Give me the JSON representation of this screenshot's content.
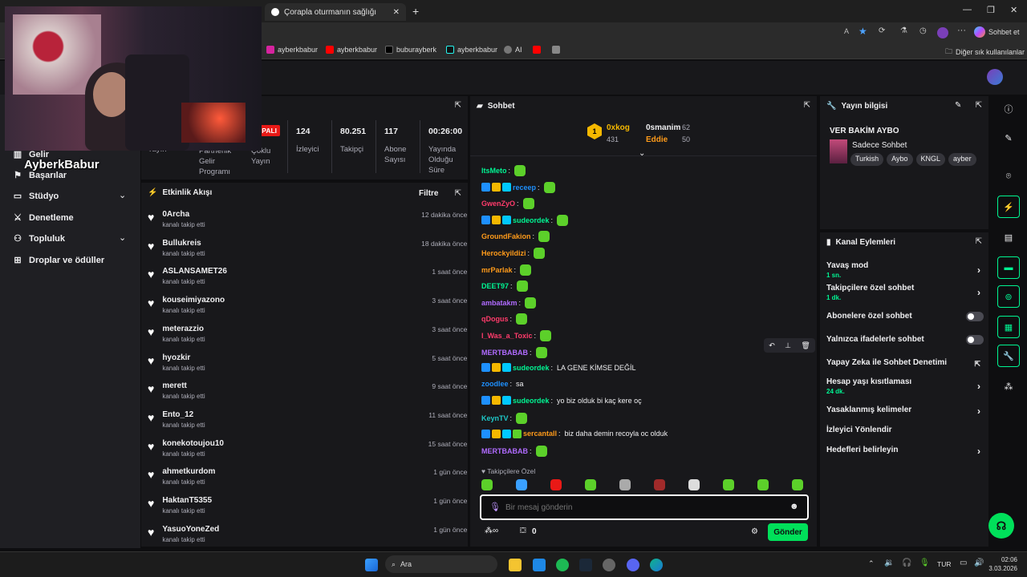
{
  "browser": {
    "tab_active_label": "Çorapla oturmanın sağlığı",
    "copilot_label": "Sohbet et",
    "bookmarks": [
      "ayberkbabur",
      "ayberkbabur",
      "buburayberk",
      "ayberkbabur",
      "AI"
    ],
    "other_bookmarks": "Diğer sık kullanılanlar"
  },
  "webcam": {
    "overlay_name": "AyberkBabur"
  },
  "sidebar": {
    "items": [
      {
        "label": "Gelir",
        "icon": "chart-icon"
      },
      {
        "label": "Başarılar",
        "icon": "trophy-icon"
      },
      {
        "label": "Stüdyo",
        "icon": "studio-icon"
      },
      {
        "label": "Denetleme",
        "icon": "sword-icon"
      },
      {
        "label": "Topluluk",
        "icon": "people-icon"
      },
      {
        "label": "Droplar ve ödüller",
        "icon": "gift-icon"
      }
    ]
  },
  "stats": {
    "status_badge": "KAPALI",
    "cols": [
      {
        "value": "",
        "label": "Yayın"
      },
      {
        "value": "",
        "label": "Partnerlik Gelir Programı"
      },
      {
        "value": "",
        "label": "Çoklu Yayın"
      },
      {
        "value": "124",
        "label": "İzleyici"
      },
      {
        "value": "80.251",
        "label": "Takipçi"
      },
      {
        "value": "117",
        "label": "Abone Sayısı"
      },
      {
        "value": "00:26:00",
        "label": "Yayında Olduğu Süre"
      }
    ]
  },
  "activity": {
    "title": "Etkinlik Akışı",
    "filter_label": "Filtre",
    "items": [
      {
        "name": "0Archa",
        "sub": "kanalı takip etti",
        "time": "12 dakika önce"
      },
      {
        "name": "Bullukreis",
        "sub": "kanalı takip etti",
        "time": "18 dakika önce"
      },
      {
        "name": "ASLANSAMET26",
        "sub": "kanalı takip etti",
        "time": "1 saat önce"
      },
      {
        "name": "kouseimiyazono",
        "sub": "kanalı takip etti",
        "time": "3 saat önce"
      },
      {
        "name": "meterazzio",
        "sub": "kanalı takip etti",
        "time": "3 saat önce"
      },
      {
        "name": "hyozkir",
        "sub": "kanalı takip etti",
        "time": "5 saat önce"
      },
      {
        "name": "merett",
        "sub": "kanalı takip etti",
        "time": "9 saat önce"
      },
      {
        "name": "Ento_12",
        "sub": "kanalı takip etti",
        "time": "11 saat önce"
      },
      {
        "name": "konekotoujou10",
        "sub": "kanalı takip etti",
        "time": "15 saat önce"
      },
      {
        "name": "ahmetkurdom",
        "sub": "kanalı takip etti",
        "time": "1 gün önce"
      },
      {
        "name": "HaktanT5355",
        "sub": "kanalı takip etti",
        "time": "1 gün önce"
      },
      {
        "name": "YasuoYoneZed",
        "sub": "kanalı takip etti",
        "time": "1 gün önce"
      }
    ]
  },
  "chat": {
    "title": "Sohbet",
    "leaderboard": {
      "rank": "1",
      "first": {
        "name": "0xkog",
        "score": "431"
      },
      "second": {
        "name": "0smanim",
        "score": "62"
      },
      "third": {
        "name": "Eddie",
        "score": "50"
      }
    },
    "messages": [
      {
        "user": "ItsMeto",
        "color": "#00f593",
        "text": "",
        "badges": 0
      },
      {
        "user": "receep",
        "color": "#1e90ff",
        "text": "",
        "badges": 3
      },
      {
        "user": "GwenZyO",
        "color": "#ff3b6b",
        "text": "",
        "badges": 0
      },
      {
        "user": "sudeordek",
        "color": "#00f593",
        "text": "",
        "badges": 3
      },
      {
        "user": "GroundFakion",
        "color": "#ff9b1a",
        "text": "",
        "badges": 0
      },
      {
        "user": "Herockyildizi",
        "color": "#ff9b1a",
        "text": "",
        "badges": 0
      },
      {
        "user": "mrParlak",
        "color": "#ff9b1a",
        "text": "",
        "badges": 0
      },
      {
        "user": "DEET97",
        "color": "#00f593",
        "text": "",
        "badges": 0
      },
      {
        "user": "ambatakm",
        "color": "#b06bff",
        "text": "",
        "badges": 0
      },
      {
        "user": "qDogus",
        "color": "#ff3b6b",
        "text": "",
        "badges": 0
      },
      {
        "user": "I_Was_a_Toxic",
        "color": "#ff3b6b",
        "text": "",
        "badges": 0
      },
      {
        "user": "MERTBABAB",
        "color": "#b06bff",
        "text": "",
        "badges": 0
      },
      {
        "user": "sudeordek",
        "color": "#00f593",
        "text": "LA GENE KİMSE DEĞİL",
        "badges": 3
      },
      {
        "user": "zoodlee",
        "color": "#1e90ff",
        "text": "sa",
        "badges": 0
      },
      {
        "user": "sudeordek",
        "color": "#00f593",
        "text": "yo biz olduk bi kaç kere oç",
        "badges": 3
      },
      {
        "user": "KeynTV",
        "color": "#1ec8c8",
        "text": "",
        "badges": 0
      },
      {
        "user": "sercantall",
        "color": "#ff9b1a",
        "text": "biz daha demin recoyla oc olduk",
        "badges": 4
      },
      {
        "user": "MERTBABAB",
        "color": "#b06bff",
        "text": "",
        "badges": 0
      }
    ],
    "emote_tray_label": "Takipçilere Özel",
    "input_placeholder": "Bir mesaj gönderin",
    "points": "0",
    "send_label": "Gönder"
  },
  "stream_info": {
    "title": "Yayın bilgisi",
    "stream_title": "VER BAKİM AYBO",
    "category": "Sadece Sohbet",
    "tags": [
      "Turkish",
      "Aybo",
      "KNGL",
      "ayber"
    ]
  },
  "channel_actions": {
    "title": "Kanal Eylemleri",
    "items": [
      {
        "label": "Yavaş mod",
        "sub": "1 sn.",
        "control": "arrow"
      },
      {
        "label": "Takipçilere özel sohbet",
        "sub": "1 dk.",
        "control": "arrow"
      },
      {
        "label": "Abonelere özel sohbet",
        "sub": "",
        "control": "toggle"
      },
      {
        "label": "Yalnızca ifadelerle sohbet",
        "sub": "",
        "control": "toggle"
      },
      {
        "label": "Yapay Zeka ile Sohbet Denetimi",
        "sub": "",
        "control": "external"
      },
      {
        "label": "Hesap yaşı kısıtlaması",
        "sub": "24 dk.",
        "control": "arrow"
      },
      {
        "label": "Yasaklanmış kelimeler",
        "sub": "",
        "control": "arrow"
      },
      {
        "label": "İzleyici Yönlendir",
        "sub": "",
        "control": "none"
      },
      {
        "label": "Hedefleri belirleyin",
        "sub": "",
        "control": "arrow"
      }
    ]
  },
  "taskbar": {
    "search_label": "Ara",
    "lang": "TUR",
    "time": "02:06",
    "date": "3.03.2026"
  },
  "colors": {
    "accent": "#00f593",
    "send_button": "#00e05a",
    "live_badge": "#e91916"
  }
}
